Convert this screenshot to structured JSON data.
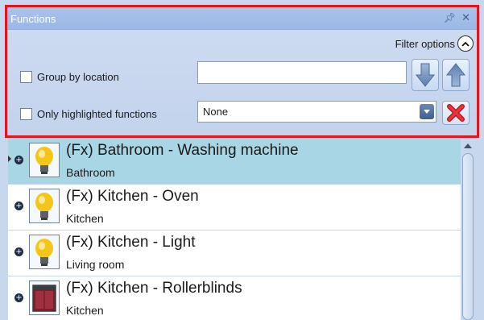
{
  "panel": {
    "title": "Functions",
    "pin_icon": "pin-icon",
    "close_icon": "close-icon"
  },
  "filter": {
    "label": "Filter options",
    "group_by_location_label": "Group by location",
    "only_highlighted_label": "Only highlighted functions",
    "search_value": "",
    "location_selected": "None"
  },
  "colors": {
    "highlight_border": "#e3141f",
    "selected_row": "#a9d6e5",
    "panel_bg": "#c7d7ee"
  },
  "functions": [
    {
      "title": "(Fx) Bathroom - Washing machine",
      "location": "Bathroom",
      "icon": "lightbulb-icon",
      "selected": true
    },
    {
      "title": "(Fx) Kitchen - Oven",
      "location": "Kitchen",
      "icon": "lightbulb-icon",
      "selected": false
    },
    {
      "title": "(Fx) Kitchen - Light",
      "location": "Living room",
      "icon": "lightbulb-icon",
      "selected": false
    },
    {
      "title": "(Fx) Kitchen - Rollerblinds",
      "location": "Kitchen",
      "icon": "rollerblind-icon",
      "selected": false
    }
  ]
}
